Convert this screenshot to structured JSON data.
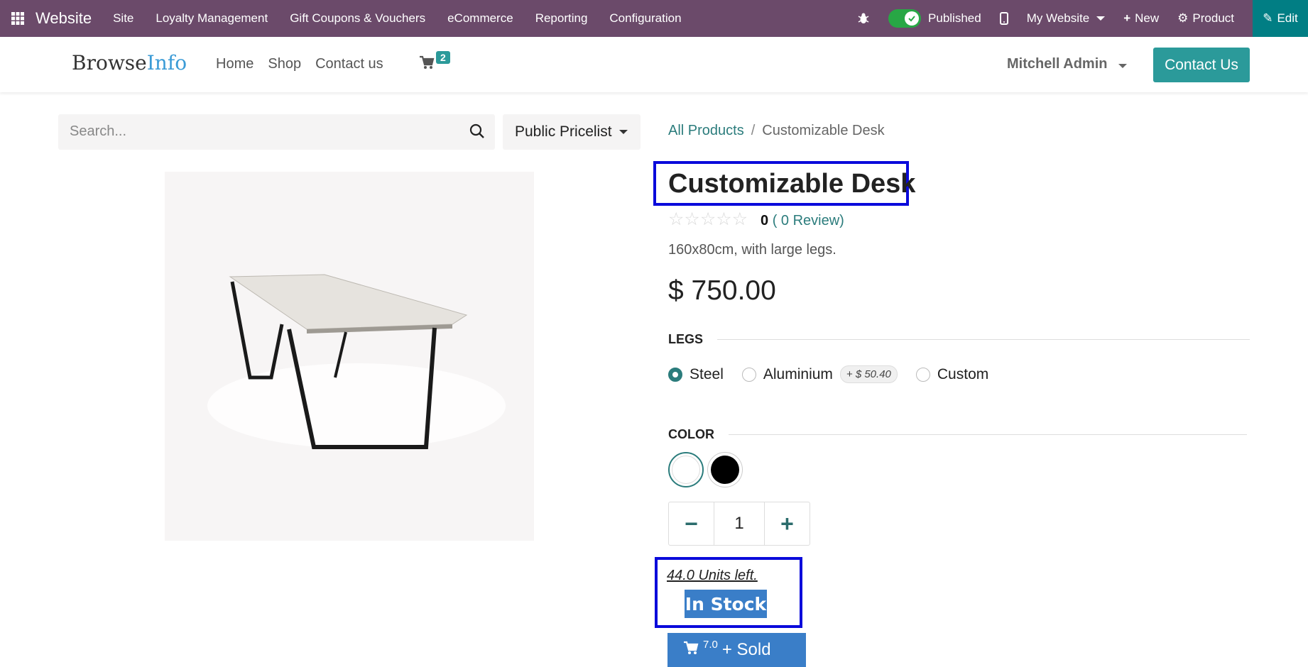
{
  "adminbar": {
    "app_name": "Website",
    "menu": [
      "Site",
      "Loyalty Management",
      "Gift Coupons & Vouchers",
      "eCommerce",
      "Reporting",
      "Configuration"
    ],
    "published_label": "Published",
    "website_label": "My Website",
    "new_label": "New",
    "product_label": "Product",
    "edit_label": "Edit"
  },
  "header": {
    "logo_part1": "Browse",
    "logo_part2": "Info",
    "nav": [
      "Home",
      "Shop",
      "Contact us"
    ],
    "cart_count": "2",
    "user": "Mitchell Admin",
    "contact_button": "Contact Us"
  },
  "search": {
    "placeholder": "Search...",
    "pricelist": "Public Pricelist"
  },
  "breadcrumb": {
    "parent": "All Products",
    "separator": "/",
    "current": "Customizable Desk"
  },
  "product": {
    "name": "Customizable Desk",
    "stars": "☆☆☆☆☆",
    "rating_count": "0",
    "review_text": "( 0 Review)",
    "description": "160x80cm, with large legs.",
    "price": "$ 750.00",
    "legs_label": "LEGS",
    "legs_options": [
      {
        "label": "Steel",
        "selected": true,
        "extra": ""
      },
      {
        "label": "Aluminium",
        "selected": false,
        "extra": "+ $ 50.40"
      },
      {
        "label": "Custom",
        "selected": false,
        "extra": ""
      }
    ],
    "color_label": "COLOR",
    "colors": [
      "#ffffff",
      "#000000"
    ],
    "quantity": "1",
    "minus": "−",
    "plus": "+",
    "units_left": "44.0 Units left.",
    "stock_status": "In Stock",
    "sold_count": "7.0",
    "sold_label": "+ Sold"
  }
}
